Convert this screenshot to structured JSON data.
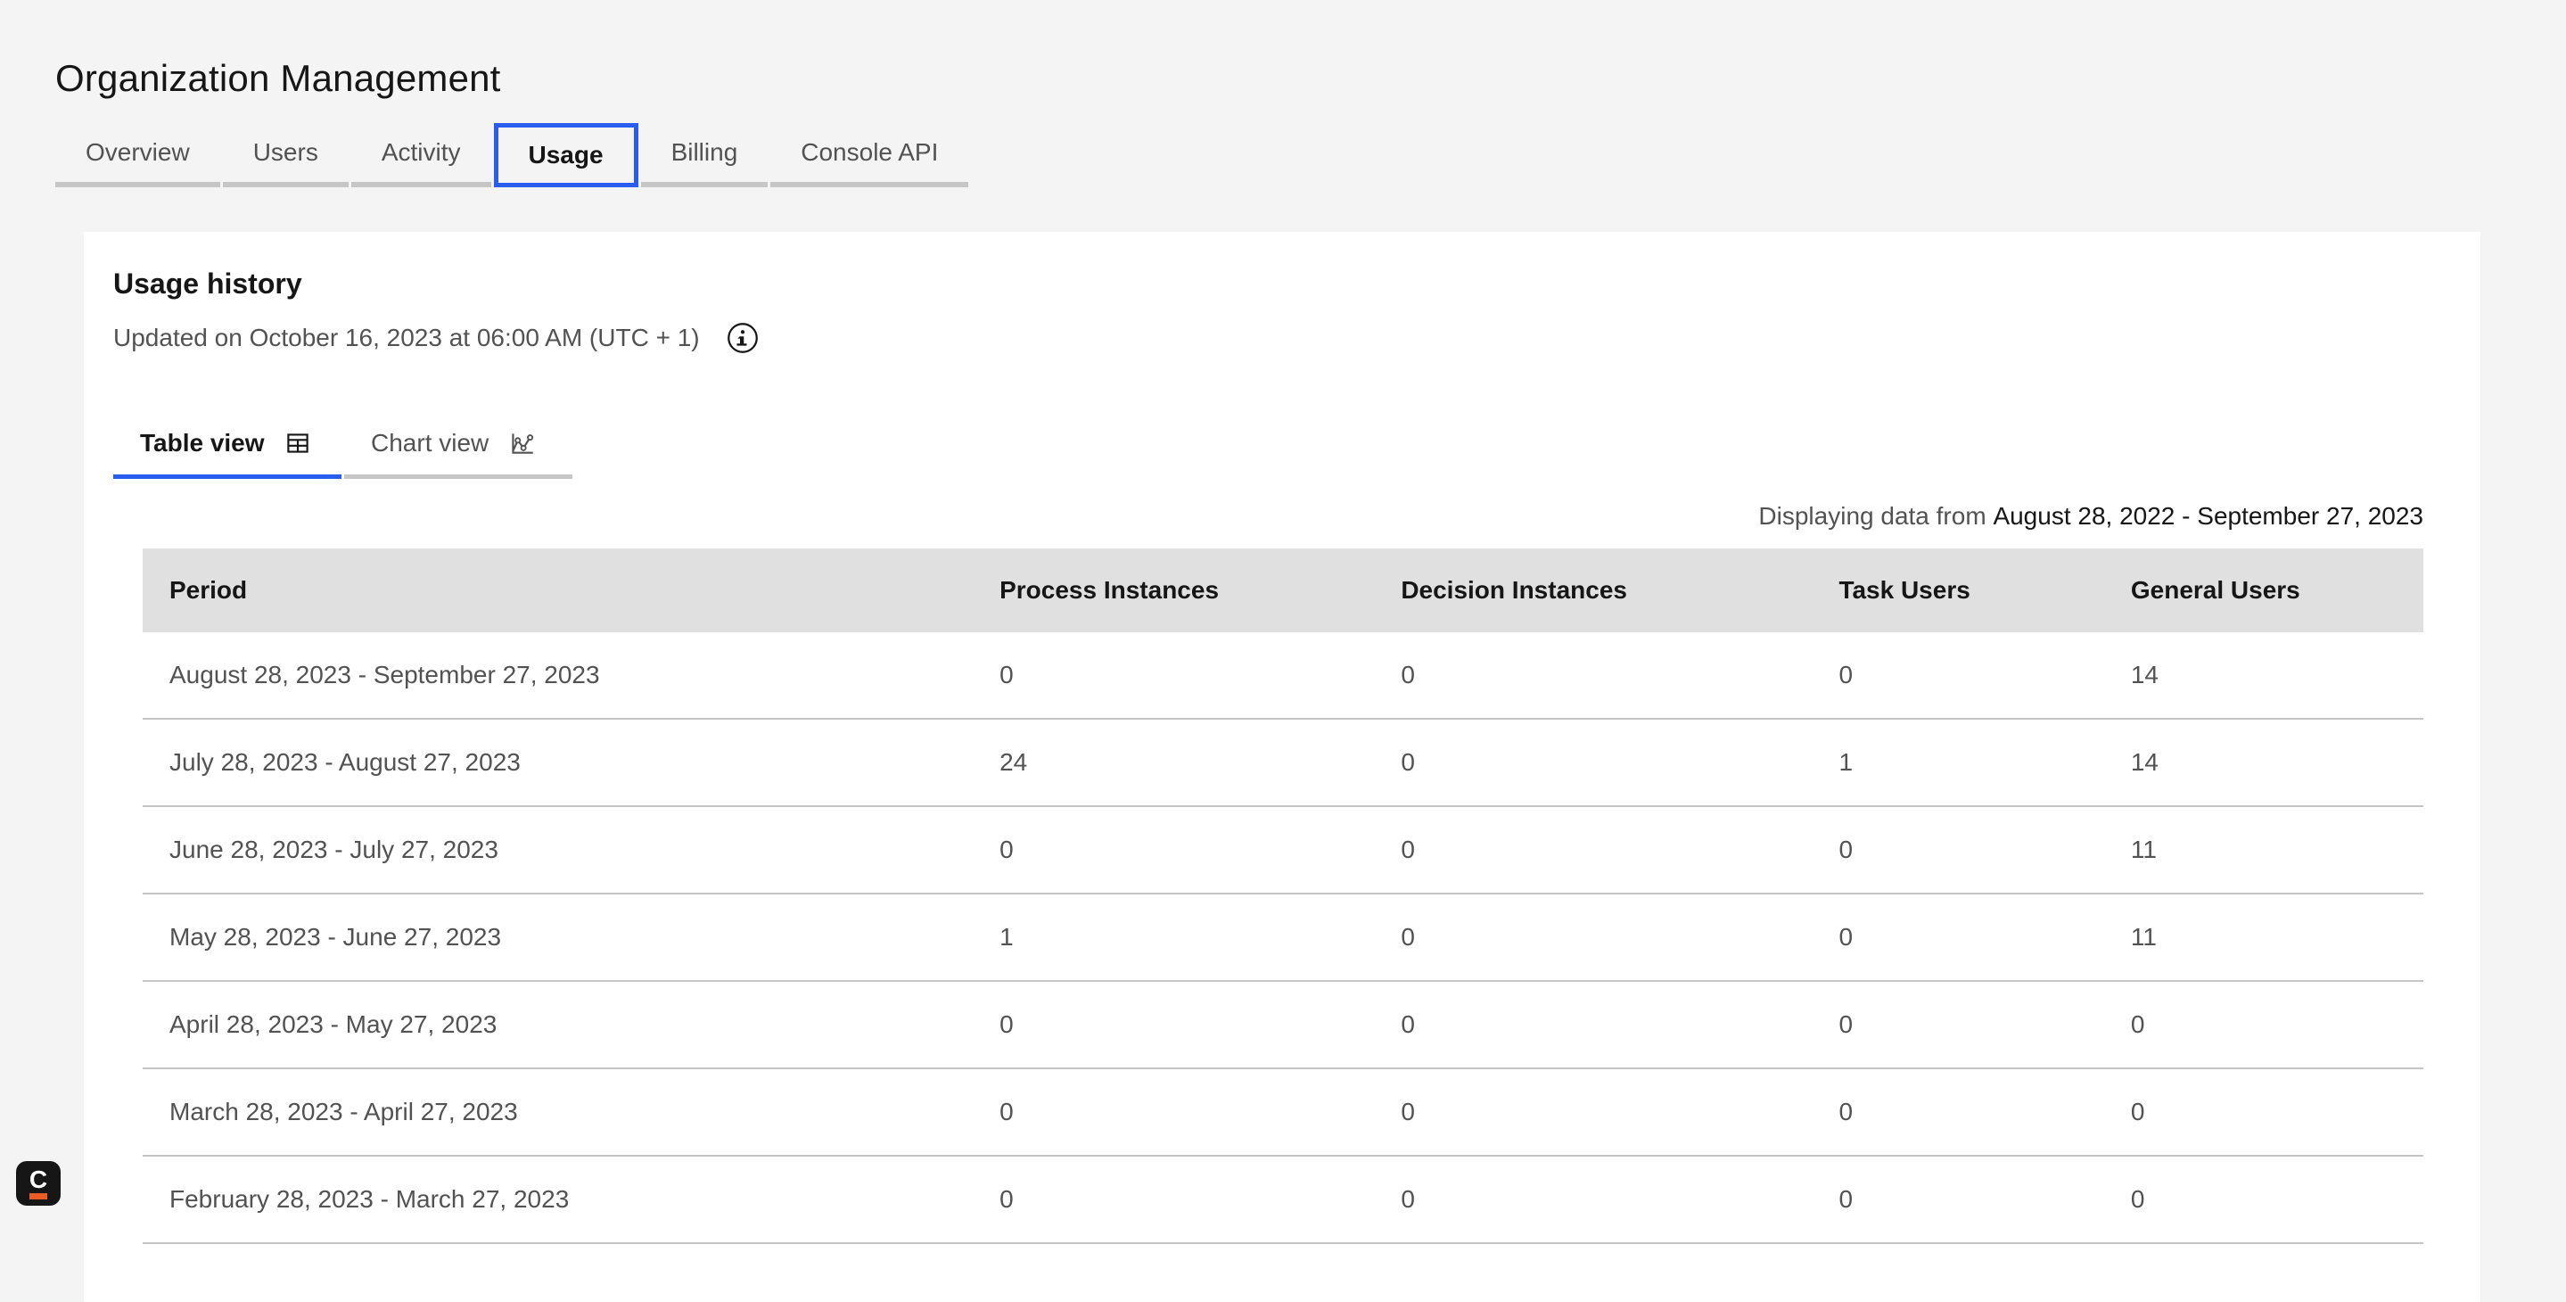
{
  "page": {
    "title": "Organization Management"
  },
  "main_tabs": [
    {
      "label": "Overview",
      "selected": false
    },
    {
      "label": "Users",
      "selected": false
    },
    {
      "label": "Activity",
      "selected": false
    },
    {
      "label": "Usage",
      "selected": true
    },
    {
      "label": "Billing",
      "selected": false
    },
    {
      "label": "Console API",
      "selected": false
    }
  ],
  "usage": {
    "heading": "Usage history",
    "updated_text": "Updated on October 16, 2023 at 06:00 AM (UTC + 1)",
    "info_icon": "information-icon",
    "view_tabs": [
      {
        "label": "Table view",
        "icon": "data-table-icon",
        "selected": true
      },
      {
        "label": "Chart view",
        "icon": "line-chart-icon",
        "selected": false
      }
    ],
    "range_prefix": "Displaying data from ",
    "range_dates": "August 28, 2022 - September 27, 2023",
    "table": {
      "columns": [
        "Period",
        "Process Instances",
        "Decision Instances",
        "Task Users",
        "General Users"
      ],
      "rows": [
        {
          "period": "August 28, 2023 - September 27, 2023",
          "process_instances": "0",
          "decision_instances": "0",
          "task_users": "0",
          "general_users": "14"
        },
        {
          "period": "July 28, 2023 - August 27, 2023",
          "process_instances": "24",
          "decision_instances": "0",
          "task_users": "1",
          "general_users": "14"
        },
        {
          "period": "June 28, 2023 - July 27, 2023",
          "process_instances": "0",
          "decision_instances": "0",
          "task_users": "0",
          "general_users": "11"
        },
        {
          "period": "May 28, 2023 - June 27, 2023",
          "process_instances": "1",
          "decision_instances": "0",
          "task_users": "0",
          "general_users": "11"
        },
        {
          "period": "April 28, 2023 - May 27, 2023",
          "process_instances": "0",
          "decision_instances": "0",
          "task_users": "0",
          "general_users": "0"
        },
        {
          "period": "March 28, 2023 - April 27, 2023",
          "process_instances": "0",
          "decision_instances": "0",
          "task_users": "0",
          "general_users": "0"
        },
        {
          "period": "February 28, 2023 - March 27, 2023",
          "process_instances": "0",
          "decision_instances": "0",
          "task_users": "0",
          "general_users": "0"
        }
      ]
    }
  },
  "widget": {
    "letter": "C"
  },
  "colors": {
    "accent_blue": "#2b5cf0",
    "page_background": "#f4f4f4",
    "card_background": "#ffffff",
    "table_header_background": "#e0e0e0",
    "divider": "#c6c6c6",
    "text_primary": "#161616",
    "text_secondary": "#525252",
    "badge_background": "#161616",
    "badge_orange": "#ea5c24"
  }
}
